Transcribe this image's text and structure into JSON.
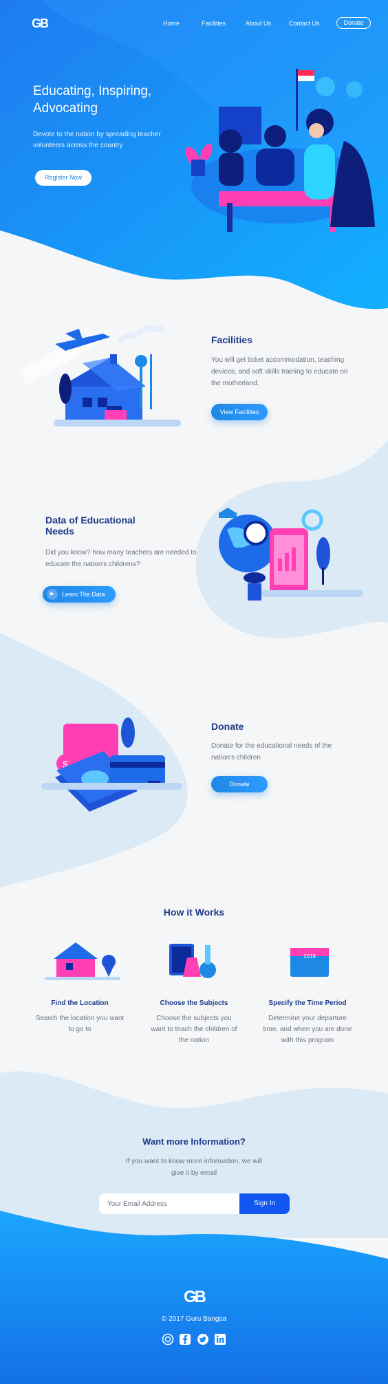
{
  "nav": {
    "logo": "GB",
    "items": [
      "Home",
      "Facilities",
      "About Us",
      "Contact Us"
    ],
    "donate": "Donate"
  },
  "hero": {
    "title_line1": "Educating, Inspiring,",
    "title_line2": "Advocating",
    "subtitle": "Devote to the nation by spreading teacher volunteers across the country",
    "cta": "Register Now"
  },
  "facilities": {
    "title": "Facilities",
    "text": "You will get ticket accommodation, teaching devices, and soft skills training to educate on the motherland.",
    "cta": "View Facilities"
  },
  "data_section": {
    "title_line1": "Data of Educational",
    "title_line2": "Needs",
    "text": "Did you know? how many teachers are needed to educate the nation's childrens?",
    "cta": "Learn The Data"
  },
  "donate_section": {
    "title": "Donate",
    "text": "Donate for the educational needs of the nation's children",
    "cta": "Donate"
  },
  "how": {
    "title": "How it Works",
    "steps": [
      {
        "title": "Find the Location",
        "text": "Search the location you want to go to"
      },
      {
        "title": "Choose the Subjects",
        "text": "Choose the subjects you want to teach the children of the nation"
      },
      {
        "title": "Specify the Time Period",
        "text": "Determine your departure time, and when you are done with this program"
      }
    ],
    "calendar_year": "2018"
  },
  "info": {
    "title": "Want more Information?",
    "text": "If you want to know more information, we will give it by email",
    "email_placeholder": "Your Email Address",
    "signin": "Sign In"
  },
  "footer": {
    "logo": "GB",
    "copyright": "©  2017 Guru Bangsa",
    "social_icons": [
      "dribbble-icon",
      "facebook-icon",
      "twitter-icon",
      "linkedin-icon"
    ]
  },
  "colors": {
    "primary": "#1e88e5",
    "dark": "#1e3a8a",
    "accent": "#ff3fb3",
    "sky": "#00b4ff"
  }
}
